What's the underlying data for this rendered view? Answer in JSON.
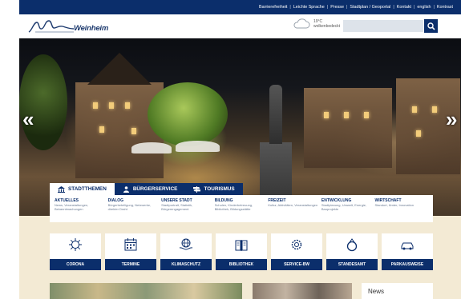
{
  "topbar": {
    "links": [
      "Barrierefreiheit",
      "Leichte Sprache",
      "Presse",
      "Stadtplan / Geoportal",
      "Kontakt",
      "english",
      "Kontrast"
    ]
  },
  "header": {
    "logo_text": "Weinheim",
    "weather_temp": "19°C",
    "weather_desc": "wolkenbedeckt",
    "search_placeholder": ""
  },
  "hero": {
    "prev_label": "«",
    "next_label": "»"
  },
  "tabs": [
    {
      "label": "Stadtthemen",
      "icon": "building-icon",
      "active": true
    },
    {
      "label": "Bürgerservice",
      "icon": "person-icon",
      "active": false
    },
    {
      "label": "Tourismus",
      "icon": "signpost-icon",
      "active": false
    }
  ],
  "themes": [
    {
      "title": "Aktuelles",
      "desc": "News, Veranstaltungen, Bekanntmachungen"
    },
    {
      "title": "Dialog",
      "desc": "Bürgerbeteiligung, Netzwerke, direkter Draht"
    },
    {
      "title": "Unsere Stadt",
      "desc": "Stadtportrait, Statistik, Bürgerengagement"
    },
    {
      "title": "Bildung",
      "desc": "Schulen, Kinderbetreuung, Bibliothek, Bildungsstätte"
    },
    {
      "title": "Freizeit",
      "desc": "Kultur, Aktivitäten, Veranstaltungen"
    },
    {
      "title": "Entwicklung",
      "desc": "Stadtplanung, Umwelt, Energie, Bauprojekte"
    },
    {
      "title": "Wirtschaft",
      "desc": "Standort, Ämter, Innovation"
    }
  ],
  "quicklinks": [
    {
      "label": "Corona",
      "icon": "virus-icon"
    },
    {
      "label": "Termine",
      "icon": "calendar-icon"
    },
    {
      "label": "Klimaschutz",
      "icon": "globe-hands-icon"
    },
    {
      "label": "Bibliothek",
      "icon": "books-icon"
    },
    {
      "label": "Service-BW",
      "icon": "gear-icon"
    },
    {
      "label": "Standesamt",
      "icon": "ring-icon"
    },
    {
      "label": "Parkausweise",
      "icon": "car-icon"
    }
  ],
  "news": {
    "label": "News"
  },
  "colors": {
    "primary": "#0b2e6b",
    "beige": "#f3ead4",
    "white": "#ffffff"
  }
}
